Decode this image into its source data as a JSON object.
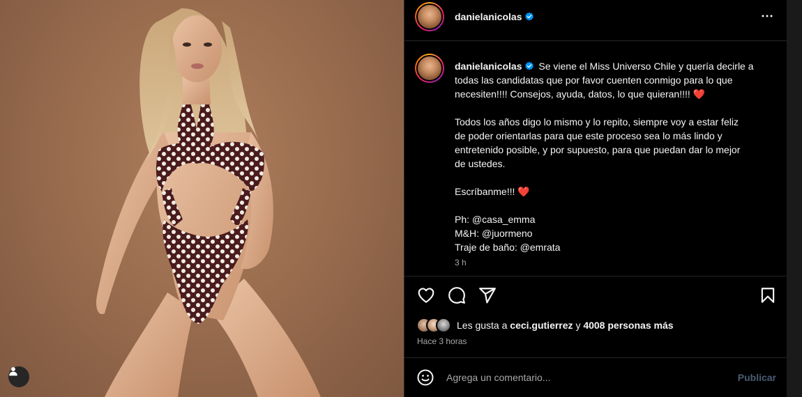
{
  "post": {
    "username": "danielanicolas",
    "caption_lines": [
      "Se viene el Miss Universo Chile y quería decirle a",
      "todas las candidatas que por favor cuenten conmigo para lo que",
      "necesiten!!!! Consejos, ayuda, datos, lo que quieran!!!!"
    ],
    "paragraph2": "Todos los años digo lo mismo y lo repito, siempre voy a estar feliz\nde poder orientarlas para que este proceso sea lo más lindo y\nentretenido posible, y por supuesto, para que puedan dar lo mejor\nde ustedes.",
    "paragraph3": "Escríbanme!!!",
    "heart_emoji": "❤️",
    "credits": "Ph: @casa_emma\nM&H: @juormeno\nTraje de baño: @emrata",
    "caption_time": "3 h",
    "likes_prefix": "Les gusta a",
    "likes_user": "ceci.gutierrez",
    "likes_connector": "y",
    "likes_others": "4008 personas más",
    "posted_ago": "Hace 3 horas"
  },
  "comment": {
    "placeholder": "Agrega un comentario...",
    "publish_label": "Publicar"
  },
  "icons": {
    "verified": "verified-badge-icon",
    "more": "more-options-icon",
    "like": "heart-icon",
    "comment": "comment-icon",
    "share": "share-icon",
    "save": "bookmark-icon",
    "emoji": "emoji-icon",
    "user_tags": "user-icon"
  },
  "colors": {
    "verified": "#0095f6",
    "heart": "#ed4956",
    "background": "#000000",
    "photo_backdrop": "#9a6d4f"
  }
}
